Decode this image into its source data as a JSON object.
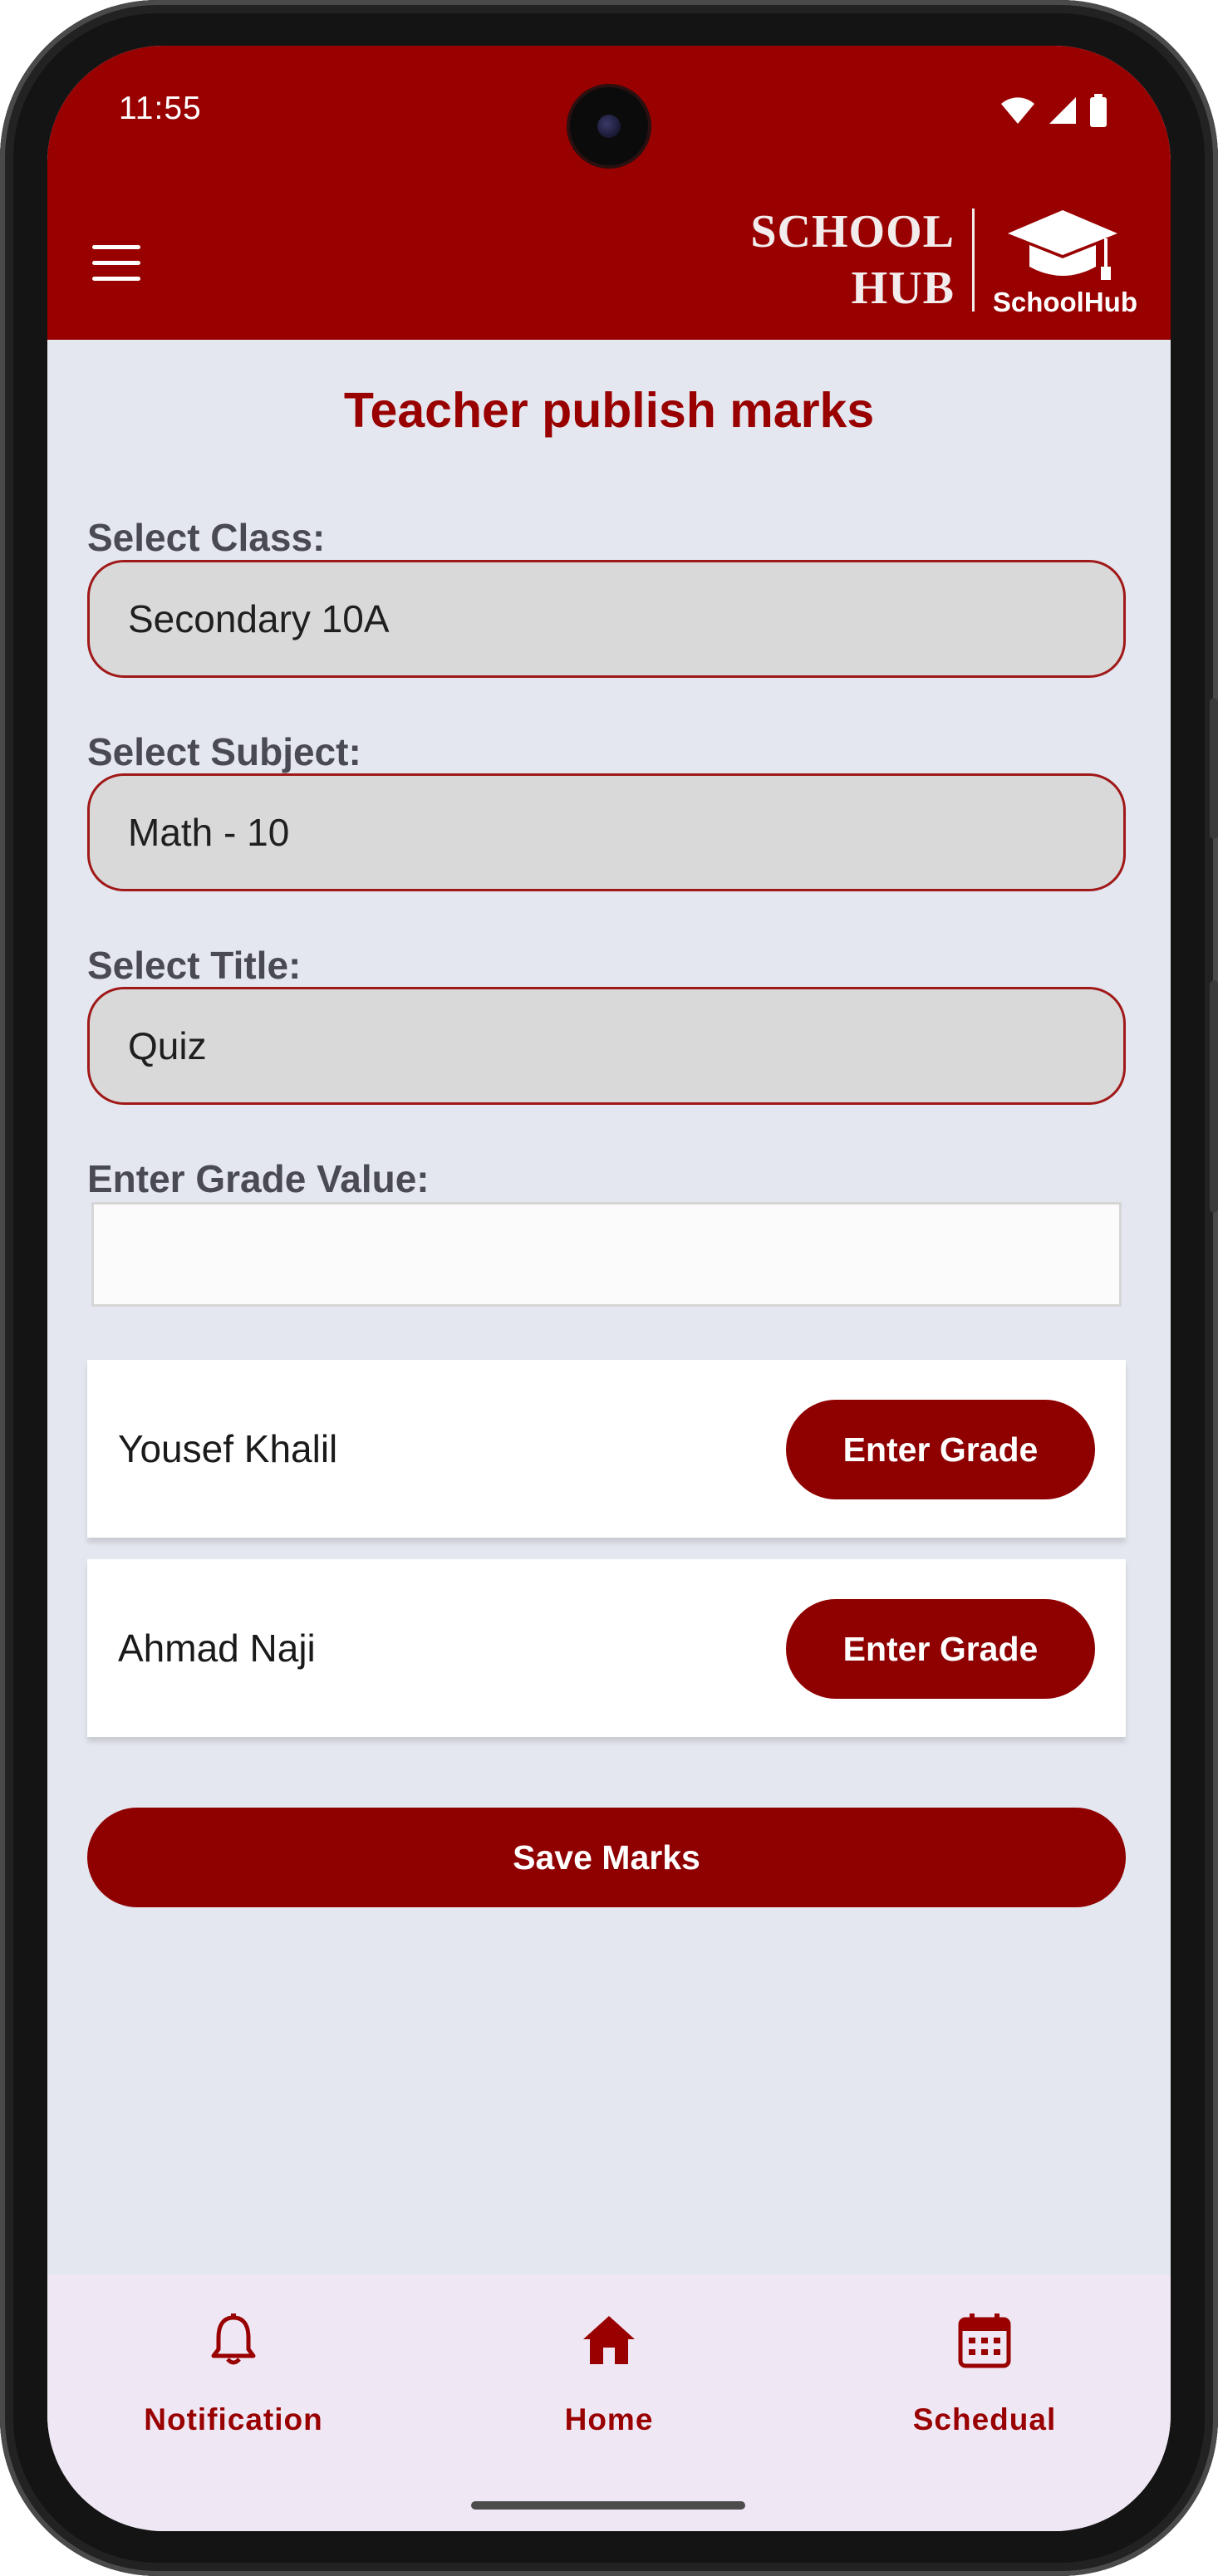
{
  "status_bar": {
    "time": "11:55"
  },
  "app_bar": {
    "logo_line1": "SCHOOL",
    "logo_line2": "HUB",
    "logo_brand": "SchoolHub"
  },
  "page": {
    "title": "Teacher publish marks"
  },
  "form": {
    "class_label": "Select Class:",
    "class_value": "Secondary 10A",
    "subject_label": "Select Subject:",
    "subject_value": "Math - 10",
    "title_label": "Select Title:",
    "title_value": "Quiz",
    "grade_label": "Enter Grade Value:",
    "grade_value": ""
  },
  "students": [
    {
      "name": "Yousef Khalil",
      "button": "Enter Grade"
    },
    {
      "name": "Ahmad Naji",
      "button": "Enter Grade"
    }
  ],
  "save_label": "Save Marks",
  "bottom_nav": [
    {
      "label": "Notification",
      "icon": "bell-icon"
    },
    {
      "label": "Home",
      "icon": "home-icon"
    },
    {
      "label": "Schedual",
      "icon": "calendar-icon"
    }
  ],
  "colors": {
    "primary": "#990000",
    "button": "#8f0000",
    "background": "#e4e7ef",
    "nav_background": "#f0e7f5"
  }
}
